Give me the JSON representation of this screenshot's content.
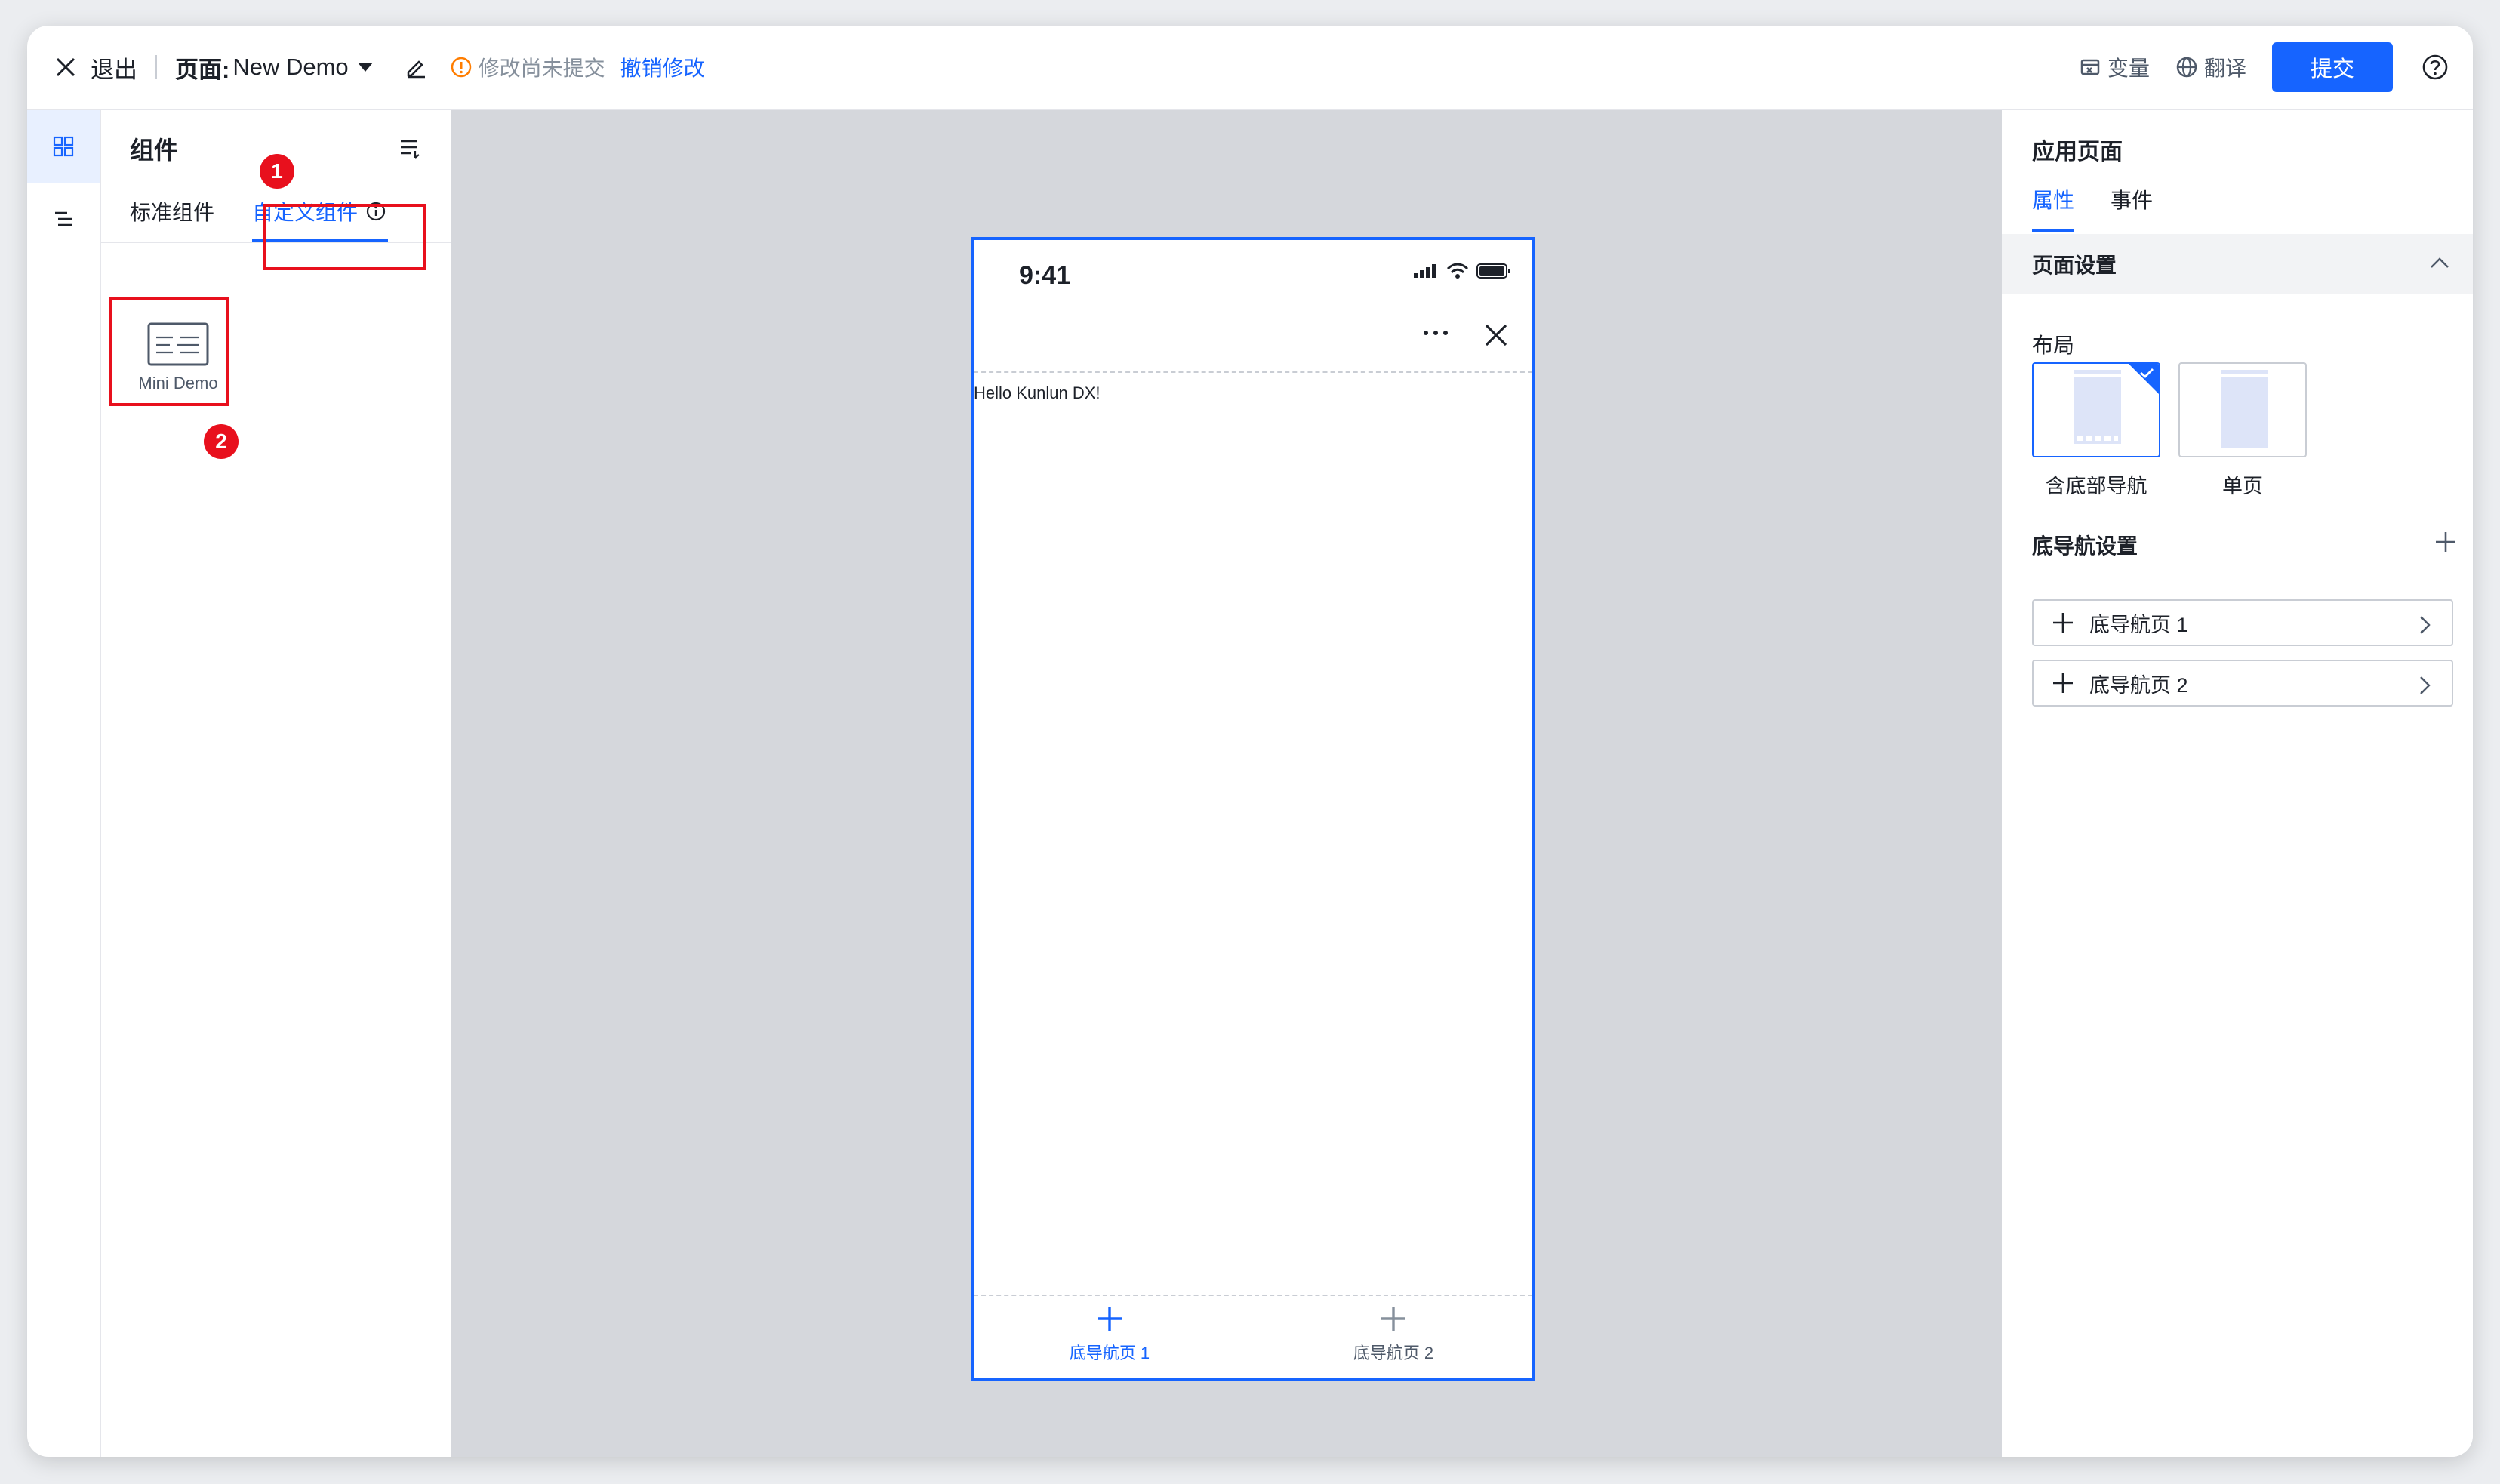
{
  "topbar": {
    "exit_label": "退出",
    "page_prefix": "页面:",
    "page_name": "New Demo",
    "unsaved_notice": "修改尚未提交",
    "revert_label": "撤销修改",
    "variables_label": "变量",
    "translate_label": "翻译",
    "submit_label": "提交"
  },
  "component_panel": {
    "title": "组件",
    "tabs": [
      {
        "label": "标准组件",
        "active": false
      },
      {
        "label": "自定义组件",
        "active": true
      }
    ],
    "items": [
      {
        "label": "Mini Demo"
      }
    ],
    "annotations": [
      "1",
      "2"
    ]
  },
  "phone_preview": {
    "time": "9:41",
    "content_text": "Hello Kunlun DX!",
    "tabbar": [
      {
        "label": "底导航页 1",
        "active": true
      },
      {
        "label": "底导航页 2",
        "active": false
      }
    ]
  },
  "right_panel": {
    "title": "应用页面",
    "tabs": [
      {
        "label": "属性",
        "active": true
      },
      {
        "label": "事件",
        "active": false
      }
    ],
    "section_title": "页面设置",
    "layout_label": "布局",
    "layout_options": [
      {
        "label": "含底部导航",
        "selected": true
      },
      {
        "label": "单页",
        "selected": false
      }
    ],
    "bottom_nav_label": "底导航设置",
    "bottom_nav_items": [
      {
        "label": "底导航页 1"
      },
      {
        "label": "底导航页 2"
      }
    ]
  },
  "colors": {
    "accent": "#1664ff",
    "annotation_red": "#e8101d",
    "warning": "#ff7d00",
    "canvas_bg": "#d5d7dc"
  },
  "icons": [
    "close-icon",
    "caret-down-icon",
    "edit-icon",
    "warning-icon",
    "variable-icon",
    "globe-icon",
    "help-icon",
    "components-grid-icon",
    "outline-list-icon",
    "list-filter-icon",
    "info-icon",
    "component-card-icon",
    "signal-icon",
    "wifi-icon",
    "battery-icon",
    "more-icon",
    "plus-icon",
    "chevron-up-icon",
    "chevron-right-icon",
    "check-icon"
  ]
}
